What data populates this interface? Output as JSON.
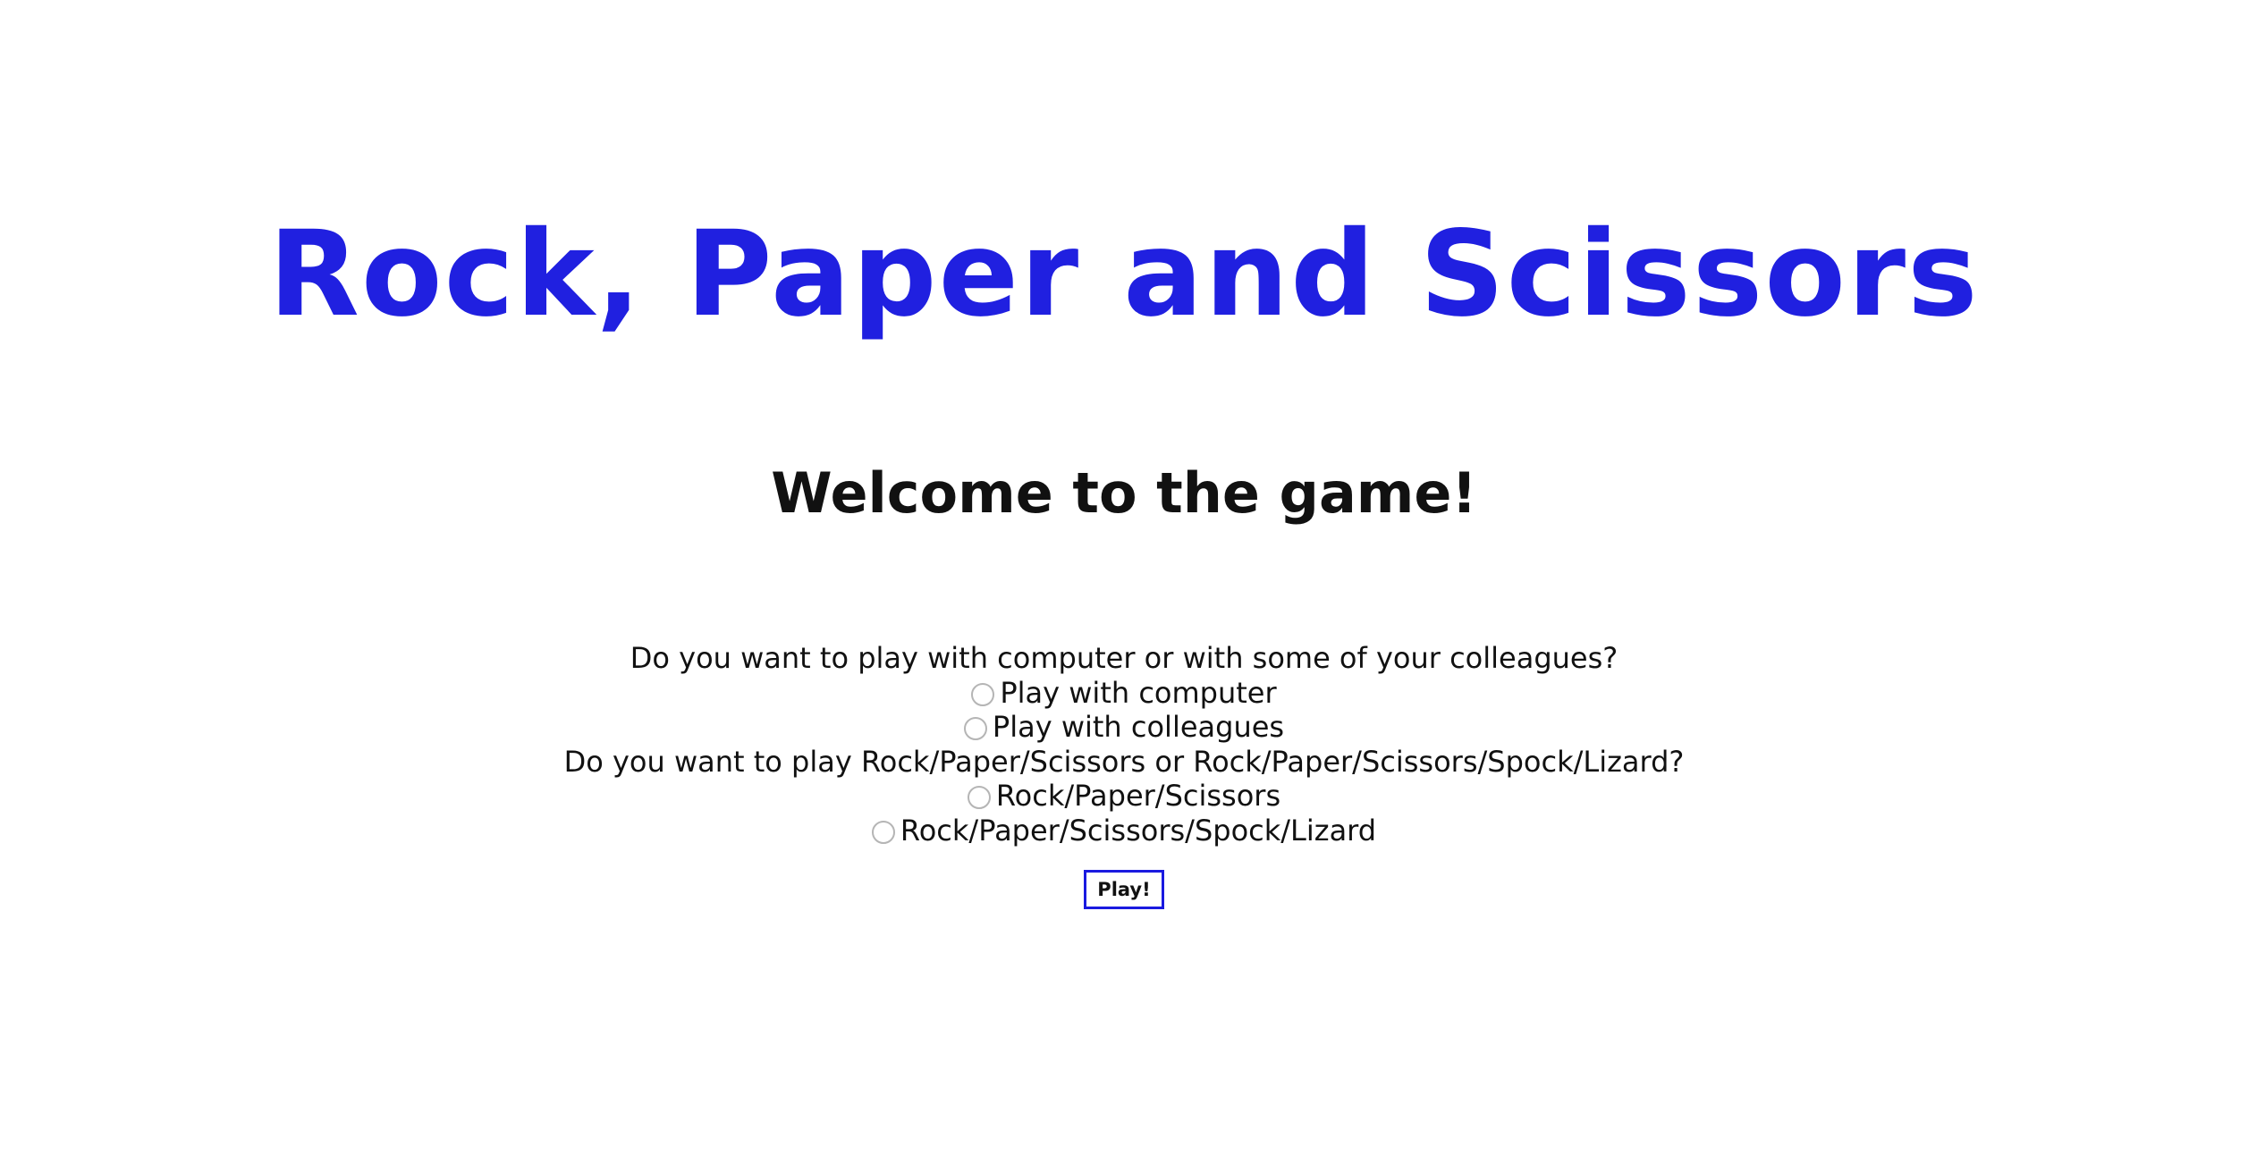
{
  "header": {
    "title": "Rock, Paper and Scissors",
    "subtitle": "Welcome to the game!"
  },
  "form": {
    "question_opponent": "Do you want to play with computer or with some of your colleagues?",
    "opponent_options": [
      {
        "label": "Play with computer",
        "selected": false
      },
      {
        "label": "Play with colleagues",
        "selected": false
      }
    ],
    "question_mode": "Do you want to play Rock/Paper/Scissors or Rock/Paper/Scissors/Spock/Lizard?",
    "mode_options": [
      {
        "label": "Rock/Paper/Scissors",
        "selected": false
      },
      {
        "label": "Rock/Paper/Scissors/Spock/Lizard",
        "selected": false
      }
    ],
    "play_label": "Play!"
  },
  "colors": {
    "title": "#2020e0",
    "text": "#111111",
    "button_border": "#1a1ae0",
    "radio_border": "#b5b5b5",
    "background": "#ffffff"
  }
}
